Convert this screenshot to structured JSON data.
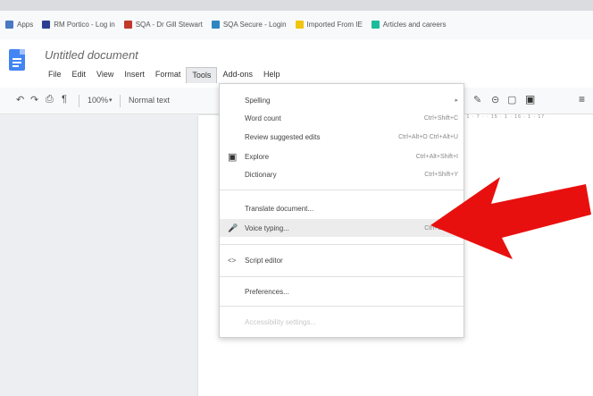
{
  "bookmarks": [
    {
      "label": "Apps",
      "color": "#4a78c2"
    },
    {
      "label": "RM Portico - Log in",
      "color": "#2c3e91"
    },
    {
      "label": "SQA - Dr Gill Stewart",
      "color": "#c0392b"
    },
    {
      "label": "SQA Secure - Login",
      "color": "#2e86c1"
    },
    {
      "label": "Imported From IE",
      "color": "#f1c40f"
    },
    {
      "label": "Articles and careers",
      "color": "#1abc9c"
    }
  ],
  "document": {
    "title": "Untitled document"
  },
  "menubar": [
    "File",
    "Edit",
    "View",
    "Insert",
    "Format",
    "Tools",
    "Add-ons",
    "Help"
  ],
  "toolbar": {
    "undo": "↶",
    "redo": "↷",
    "print": "⎙",
    "paint_format": "¶",
    "zoom": "100%",
    "zoom_caret": "▾",
    "style": "Normal text",
    "pen": "✎",
    "link": "⊝",
    "comment": "▢",
    "image": "▣",
    "align": "≡"
  },
  "ruler": "· 1 · · 6 · 1 · 7 · · 15 · 1 · 16 · 1 · 17",
  "tools_menu": {
    "items": [
      {
        "label": "Spelling",
        "shortcut": "▸",
        "icon": ""
      },
      {
        "label": "Word count",
        "shortcut": "Ctrl+Shift+C",
        "icon": ""
      },
      {
        "label": "Review suggested edits",
        "shortcut": "Ctrl+Alt+O Ctrl+Alt+U",
        "icon": ""
      },
      {
        "label": "Explore",
        "shortcut": "Ctrl+Alt+Shift+I",
        "icon": "▣"
      },
      {
        "label": "Dictionary",
        "shortcut": "Ctrl+Shift+Y",
        "icon": ""
      },
      {
        "label": "Translate document...",
        "shortcut": "",
        "icon": ""
      },
      {
        "label": "Voice typing...",
        "shortcut": "Ctrl+Shift+S",
        "icon": "🎤"
      },
      {
        "label": "Script editor",
        "shortcut": "",
        "icon": "<>"
      },
      {
        "label": "Preferences...",
        "shortcut": "",
        "icon": ""
      },
      {
        "label": "Accessibility settings...",
        "shortcut": "",
        "icon": ""
      }
    ]
  },
  "colors": {
    "arrow": "#e8100f",
    "docs_blue": "#4285f4"
  }
}
